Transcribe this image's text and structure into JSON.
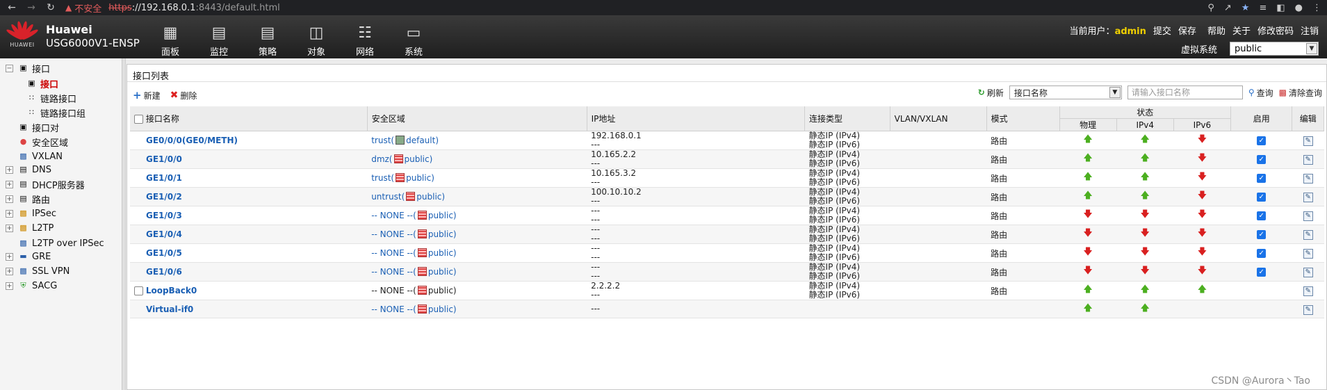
{
  "browser": {
    "back_icon": "back-arrow-icon",
    "insecure_label": "不安全",
    "url_scheme": "https",
    "url_host": "://192.168.0.1",
    "url_path": ":8443/default.html"
  },
  "header": {
    "brand": "HUAWEI",
    "product_line1": "Huawei",
    "product_line2": "USG6000V1-ENSP",
    "nav": [
      {
        "label": "面板",
        "icon": "dashboard-icon"
      },
      {
        "label": "监控",
        "icon": "monitor-icon"
      },
      {
        "label": "策略",
        "icon": "policy-icon"
      },
      {
        "label": "对象",
        "icon": "object-icon"
      },
      {
        "label": "网络",
        "icon": "network-icon"
      },
      {
        "label": "系统",
        "icon": "system-icon"
      }
    ],
    "current_user_label": "当前用户：",
    "current_user": "admin",
    "commit": "提交",
    "save": "保存",
    "help": "帮助",
    "about": "关于",
    "change_password": "修改密码",
    "logout": "注销",
    "vsys_label": "虚拟系统",
    "vsys_value": "public"
  },
  "sidebar": {
    "items": [
      {
        "label": "接口"
      },
      {
        "label": "接口"
      },
      {
        "label": "链路接口"
      },
      {
        "label": "链路接口组"
      },
      {
        "label": "接口对"
      },
      {
        "label": "安全区域"
      },
      {
        "label": "VXLAN"
      },
      {
        "label": "DNS"
      },
      {
        "label": "DHCP服务器"
      },
      {
        "label": "路由"
      },
      {
        "label": "IPSec"
      },
      {
        "label": "L2TP"
      },
      {
        "label": "L2TP over IPSec"
      },
      {
        "label": "GRE"
      },
      {
        "label": "SSL VPN"
      },
      {
        "label": "SACG"
      }
    ]
  },
  "panel": {
    "title": "接口列表",
    "new_label": "新建",
    "delete_label": "删除",
    "refresh_label": "刷新",
    "search_field": "接口名称",
    "search_placeholder": "请输入接口名称",
    "query_label": "查询",
    "clear_label": "清除查询"
  },
  "table": {
    "headers": {
      "name": "接口名称",
      "zone": "安全区域",
      "ip": "IP地址",
      "conn_type": "连接类型",
      "vlan": "VLAN/VXLAN",
      "mode": "模式",
      "status": "状态",
      "physical": "物理",
      "ipv4": "IPv4",
      "ipv6": "IPv6",
      "enable": "启用",
      "edit": "编辑"
    },
    "rows": [
      {
        "name": "GE0/0/0(GE0/METH)",
        "zone_prefix": "trust(",
        "zone_vsys": "default)",
        "zone_link": true,
        "ip1": "192.168.0.1",
        "ip2": "---",
        "conn1": "静态IP (IPv4)",
        "conn2": "静态IP (IPv6)",
        "mode": "路由",
        "physical": "up",
        "ipv4": "up",
        "ipv6": "down",
        "enabled": true
      },
      {
        "name": "GE1/0/0",
        "zone_prefix": "dmz(",
        "zone_vsys": "public)",
        "zone_link": true,
        "ip1": "10.165.2.2",
        "ip2": "---",
        "conn1": "静态IP (IPv4)",
        "conn2": "静态IP (IPv6)",
        "mode": "路由",
        "physical": "up",
        "ipv4": "up",
        "ipv6": "down",
        "enabled": true
      },
      {
        "name": "GE1/0/1",
        "zone_prefix": "trust(",
        "zone_vsys": "public)",
        "zone_link": true,
        "ip1": "10.165.3.2",
        "ip2": "---",
        "conn1": "静态IP (IPv4)",
        "conn2": "静态IP (IPv6)",
        "mode": "路由",
        "physical": "up",
        "ipv4": "up",
        "ipv6": "down",
        "enabled": true
      },
      {
        "name": "GE1/0/2",
        "zone_prefix": "untrust(",
        "zone_vsys": "public)",
        "zone_link": true,
        "ip1": "100.10.10.2",
        "ip2": "---",
        "conn1": "静态IP (IPv4)",
        "conn2": "静态IP (IPv6)",
        "mode": "路由",
        "physical": "up",
        "ipv4": "up",
        "ipv6": "down",
        "enabled": true
      },
      {
        "name": "GE1/0/3",
        "zone_prefix": "-- NONE --(",
        "zone_vsys": "public)",
        "zone_link": true,
        "ip1": "---",
        "ip2": "---",
        "conn1": "静态IP (IPv4)",
        "conn2": "静态IP (IPv6)",
        "mode": "路由",
        "physical": "down",
        "ipv4": "down",
        "ipv6": "down",
        "enabled": true
      },
      {
        "name": "GE1/0/4",
        "zone_prefix": "-- NONE --(",
        "zone_vsys": "public)",
        "zone_link": true,
        "ip1": "---",
        "ip2": "---",
        "conn1": "静态IP (IPv4)",
        "conn2": "静态IP (IPv6)",
        "mode": "路由",
        "physical": "down",
        "ipv4": "down",
        "ipv6": "down",
        "enabled": true
      },
      {
        "name": "GE1/0/5",
        "zone_prefix": "-- NONE --(",
        "zone_vsys": "public)",
        "zone_link": true,
        "ip1": "---",
        "ip2": "---",
        "conn1": "静态IP (IPv4)",
        "conn2": "静态IP (IPv6)",
        "mode": "路由",
        "physical": "down",
        "ipv4": "down",
        "ipv6": "down",
        "enabled": true
      },
      {
        "name": "GE1/0/6",
        "zone_prefix": "-- NONE --(",
        "zone_vsys": "public)",
        "zone_link": true,
        "ip1": "---",
        "ip2": "---",
        "conn1": "静态IP (IPv4)",
        "conn2": "静态IP (IPv6)",
        "mode": "路由",
        "physical": "down",
        "ipv4": "down",
        "ipv6": "down",
        "enabled": true
      },
      {
        "name": "LoopBack0",
        "zone_prefix": "-- NONE --(",
        "zone_vsys": "public)",
        "zone_link": false,
        "ip1": "2.2.2.2",
        "ip2": "---",
        "conn1": "静态IP (IPv4)",
        "conn2": "静态IP (IPv6)",
        "mode": "路由",
        "physical": "up",
        "ipv4": "up",
        "ipv6": "up",
        "enabled": null
      },
      {
        "name": "Virtual-if0",
        "zone_prefix": "-- NONE --(",
        "zone_vsys": "public)",
        "zone_link": true,
        "ip1": "---",
        "ip2": "",
        "conn1": "",
        "conn2": "",
        "mode": "",
        "physical": "up",
        "ipv4": "up",
        "ipv6": "",
        "enabled": null
      }
    ]
  },
  "watermark": "CSDN @Aurora丶Tao"
}
